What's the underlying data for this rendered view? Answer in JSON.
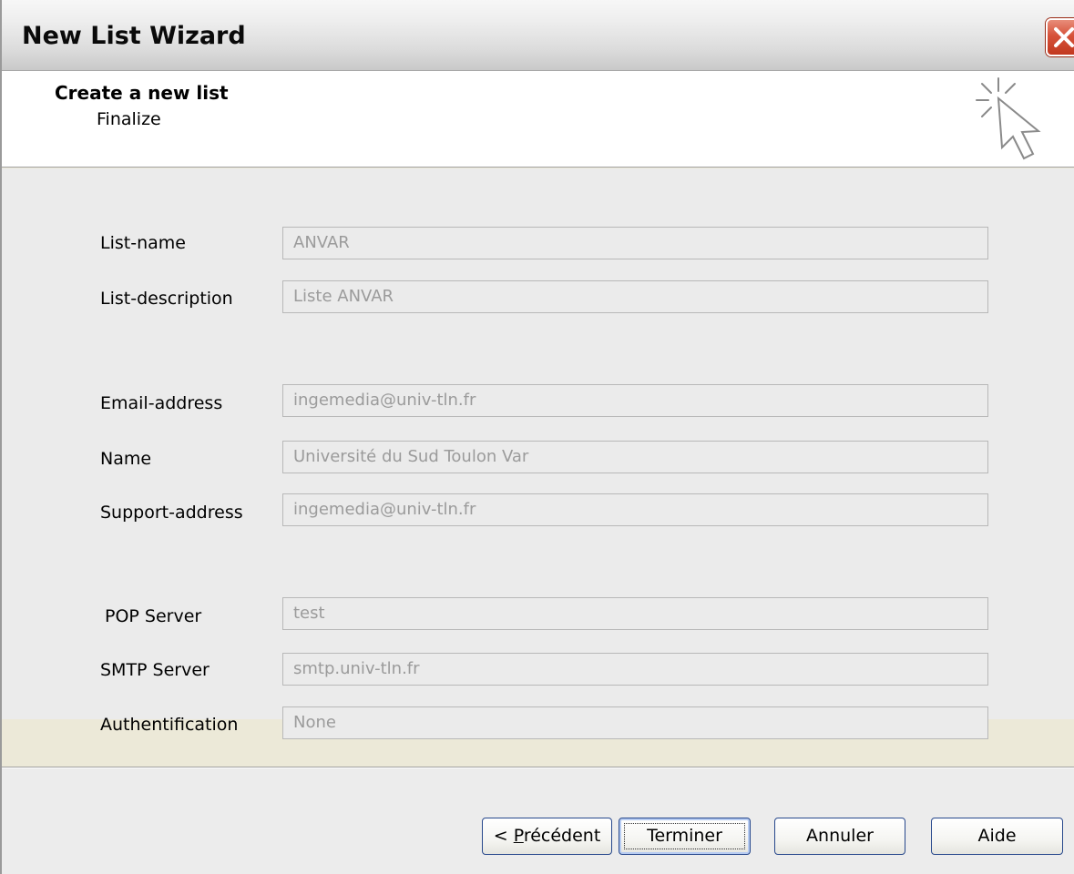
{
  "window": {
    "title": "New List Wizard"
  },
  "header": {
    "title": "Create a new list",
    "subtitle": "Finalize",
    "icon": "wizard-cursor-icon"
  },
  "fields": [
    {
      "label": "List-name",
      "value": "ANVAR"
    },
    {
      "label": "List-description",
      "value": "Liste ANVAR"
    },
    {
      "label": "Email-address",
      "value": "ingemedia@univ-tln.fr"
    },
    {
      "label": "Name",
      "value": "Université du Sud Toulon Var"
    },
    {
      "label": "Support-address",
      "value": "ingemedia@univ-tln.fr"
    },
    {
      "label": "POP Server",
      "value": "test"
    },
    {
      "label": "SMTP Server",
      "value": "smtp.univ-tln.fr"
    },
    {
      "label": "Authentification",
      "value": "None"
    }
  ],
  "buttons": {
    "previous_prefix": "< ",
    "previous_mnemonic": "P",
    "previous_rest": "récédent",
    "finish": "Terminer",
    "cancel": "Annuler",
    "help": "Aide"
  },
  "colors": {
    "close_button": "#d6523a",
    "button_border": "#27488c"
  }
}
